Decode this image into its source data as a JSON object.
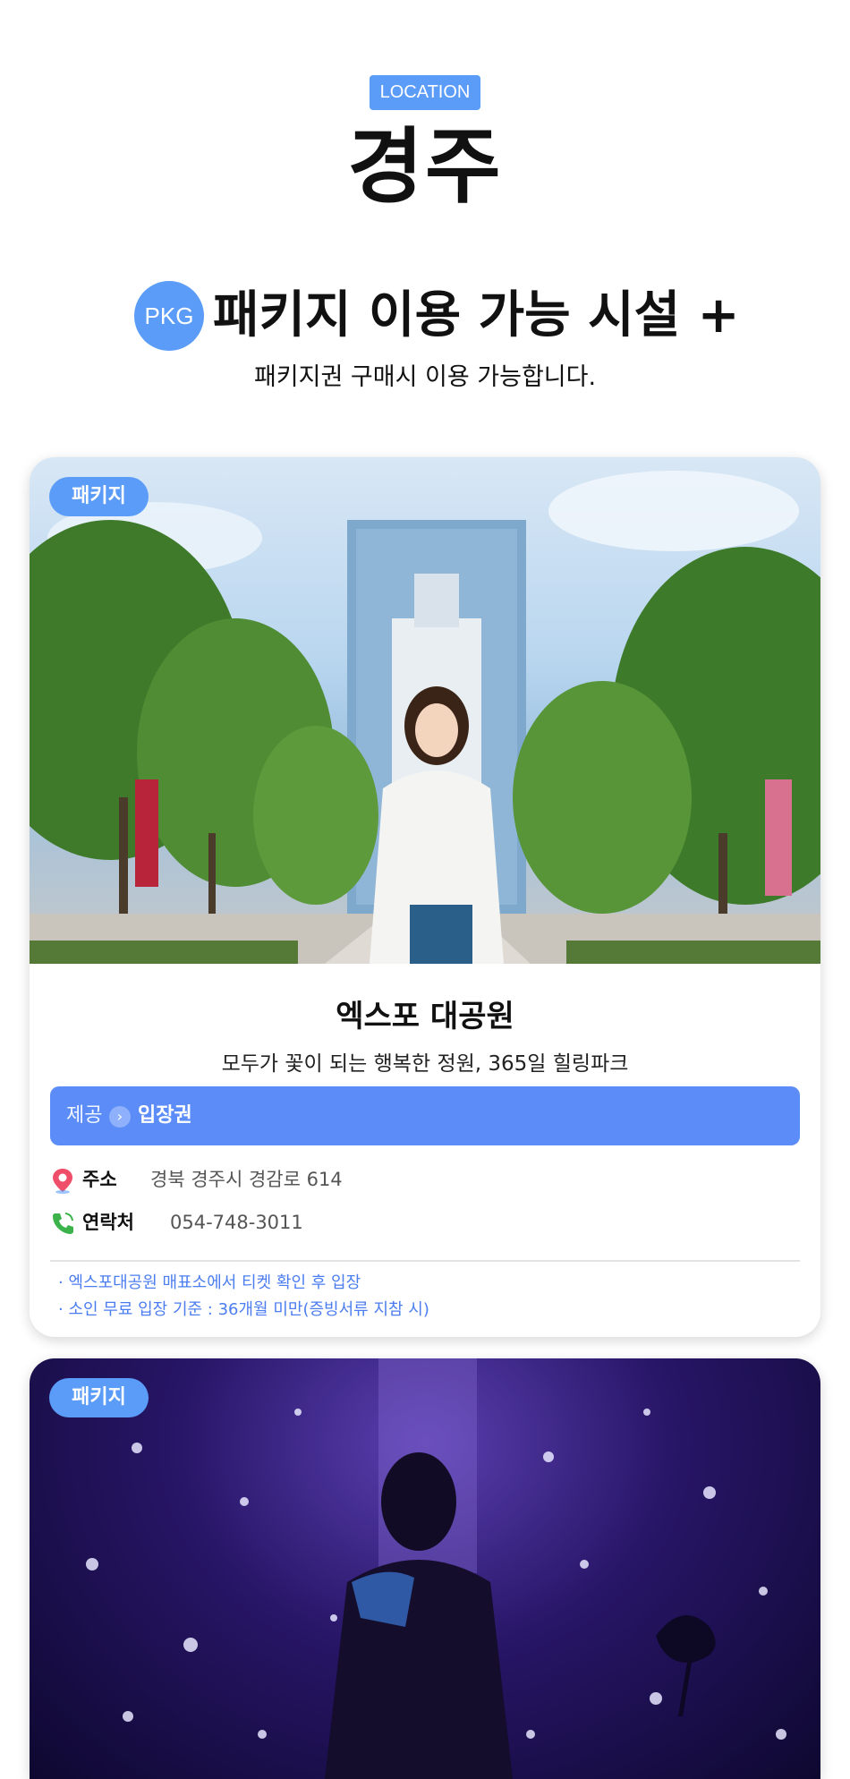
{
  "header": {
    "location_badge": "LOCATION",
    "city": "경주",
    "pkg_badge": "PKG",
    "pkg_title": "패키지 이용 가능 시설 +",
    "pkg_subtitle": "패키지권 구매시 이용 가능합니다."
  },
  "cards": [
    {
      "tag": "패키지",
      "name": "엑스포 대공원",
      "description": "모두가 꽃이 되는 행복한 정원, 365일 힐링파크",
      "provide_label": "제공",
      "provide_value": "입장권",
      "address_label": "주소",
      "address": "경북 경주시 경감로 614",
      "contact_label": "연락처",
      "contact": "054-748-3011",
      "notes": [
        "· 엑스포대공원 매표소에서 티켓 확인 후 입장",
        "· 소인 무료 입장 기준 : 36개월 미만(증빙서류 지참 시)"
      ]
    },
    {
      "tag": "패키지"
    }
  ],
  "colors": {
    "accent": "#5b9cf8",
    "provide_bar": "#5b8cf8",
    "note_text": "#4b7df0"
  },
  "icons": {
    "address": "map-pin-icon",
    "contact": "phone-icon",
    "provide": "chevron-right-icon"
  }
}
